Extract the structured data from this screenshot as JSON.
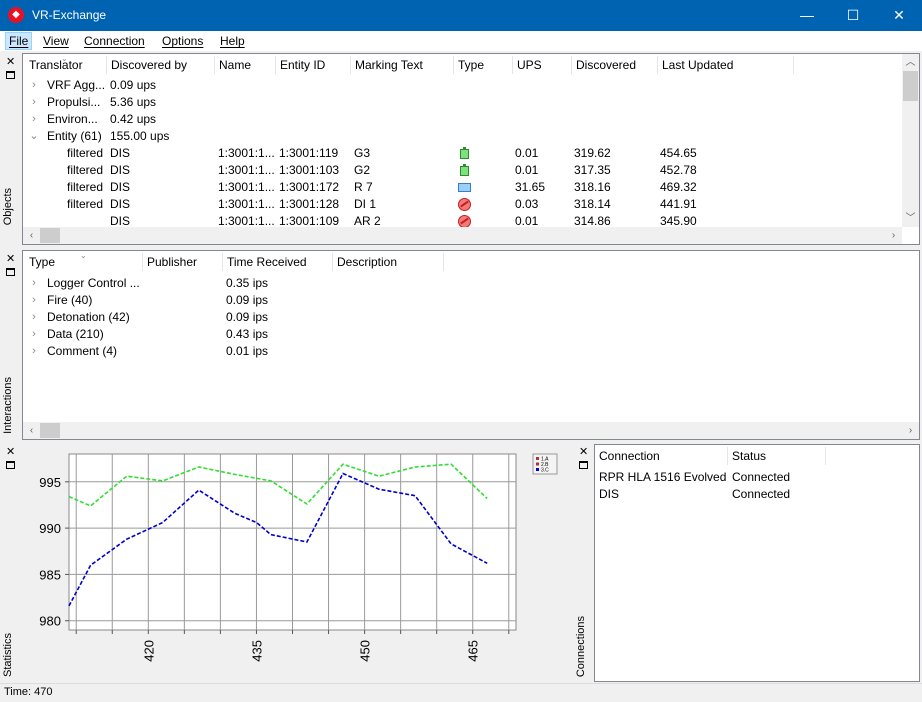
{
  "window": {
    "title": "VR-Exchange",
    "minimize_glyph": "—",
    "maximize_glyph": "☐",
    "close_glyph": "✕"
  },
  "menu": [
    "File",
    "View",
    "Connection",
    "Options",
    "Help"
  ],
  "panels": {
    "objects_label": "Objects",
    "interactions_label": "Interactions",
    "statistics_label": "Statistics",
    "connections_label": "Connections",
    "close_glyph": "✕"
  },
  "objects": {
    "columns": [
      "Translator",
      "Discovered by",
      "Name",
      "Entity ID",
      "Marking Text",
      "Type",
      "UPS",
      "Discovered",
      "Last Updated"
    ],
    "groups": [
      {
        "label": "VRF Agg...",
        "rate": "0.09 ups"
      },
      {
        "label": "Propulsi...",
        "rate": "5.36 ups"
      },
      {
        "label": "Environ...",
        "rate": "0.42 ups"
      },
      {
        "label": "Entity (61)",
        "rate": "155.00 ups"
      }
    ],
    "rows": [
      {
        "translator": "filtered",
        "discovered_by": "DIS",
        "name": "1:3001:1...",
        "entity_id": "1:3001:119",
        "marking": "G3",
        "type_icon": "ok-icon",
        "ups": "0.01",
        "discovered": "319.62",
        "last_updated": "454.65"
      },
      {
        "translator": "filtered",
        "discovered_by": "DIS",
        "name": "1:3001:1...",
        "entity_id": "1:3001:103",
        "marking": "G2",
        "type_icon": "ok-icon",
        "ups": "0.01",
        "discovered": "317.35",
        "last_updated": "452.78"
      },
      {
        "translator": "filtered",
        "discovered_by": "DIS",
        "name": "1:3001:1...",
        "entity_id": "1:3001:172",
        "marking": "R 7",
        "type_icon": "mail-icon",
        "ups": "31.65",
        "discovered": "318.16",
        "last_updated": "469.32"
      },
      {
        "translator": "filtered",
        "discovered_by": "DIS",
        "name": "1:3001:1...",
        "entity_id": "1:3001:128",
        "marking": "DI 1",
        "type_icon": "no-entry-icon",
        "ups": "0.03",
        "discovered": "318.14",
        "last_updated": "441.91"
      },
      {
        "translator": "",
        "discovered_by": "DIS",
        "name": "1:3001:1...",
        "entity_id": "1:3001:109",
        "marking": "AR 2",
        "type_icon": "no-entry-icon",
        "ups": "0.01",
        "discovered": "314.86",
        "last_updated": "345.90"
      }
    ]
  },
  "interactions": {
    "columns": [
      "Type",
      "Publisher",
      "Time Received",
      "Description"
    ],
    "rows": [
      {
        "type": "Logger Control ...",
        "rate": "0.35 ips"
      },
      {
        "type": "Fire (40)",
        "rate": "0.09 ips"
      },
      {
        "type": "Detonation (42)",
        "rate": "0.09 ips"
      },
      {
        "type": "Data (210)",
        "rate": "0.43 ips"
      },
      {
        "type": "Comment (4)",
        "rate": "0.01 ips"
      }
    ]
  },
  "connections": {
    "columns": [
      "Connection",
      "Status"
    ],
    "rows": [
      {
        "connection": "RPR HLA 1516 Evolved",
        "status": "Connected"
      },
      {
        "connection": "DIS",
        "status": "Connected"
      }
    ]
  },
  "chart_data": {
    "type": "line",
    "xlim": [
      409,
      471
    ],
    "ylim": [
      979,
      998
    ],
    "x_ticks": [
      420,
      435,
      450,
      465
    ],
    "y_ticks": [
      980,
      985,
      990,
      995
    ],
    "grid": true,
    "legend_position": "top-right",
    "legend_text": [
      "1.A",
      "2.B",
      "3.C"
    ],
    "series": [
      {
        "color": "#33dd33",
        "dash": true,
        "points": [
          [
            409,
            993.4
          ],
          [
            412,
            992.4
          ],
          [
            417,
            995.6
          ],
          [
            422,
            995.1
          ],
          [
            427,
            996.6
          ],
          [
            432,
            995.8
          ],
          [
            437,
            995.1
          ],
          [
            442,
            992.6
          ],
          [
            447,
            996.9
          ],
          [
            452,
            995.6
          ],
          [
            457,
            996.6
          ],
          [
            462,
            996.9
          ],
          [
            467,
            993.2
          ]
        ]
      },
      {
        "color": "#0000cc",
        "dash": true,
        "points": [
          [
            409,
            981.6
          ],
          [
            412,
            986.0
          ],
          [
            417,
            988.8
          ],
          [
            422,
            990.6
          ],
          [
            427,
            994.1
          ],
          [
            432,
            991.6
          ],
          [
            435,
            990.6
          ],
          [
            437,
            989.3
          ],
          [
            442,
            988.5
          ],
          [
            447,
            995.9
          ],
          [
            452,
            994.2
          ],
          [
            457,
            993.5
          ],
          [
            462,
            988.3
          ],
          [
            467,
            986.2
          ]
        ]
      }
    ]
  },
  "status": {
    "time": "Time: 470"
  }
}
